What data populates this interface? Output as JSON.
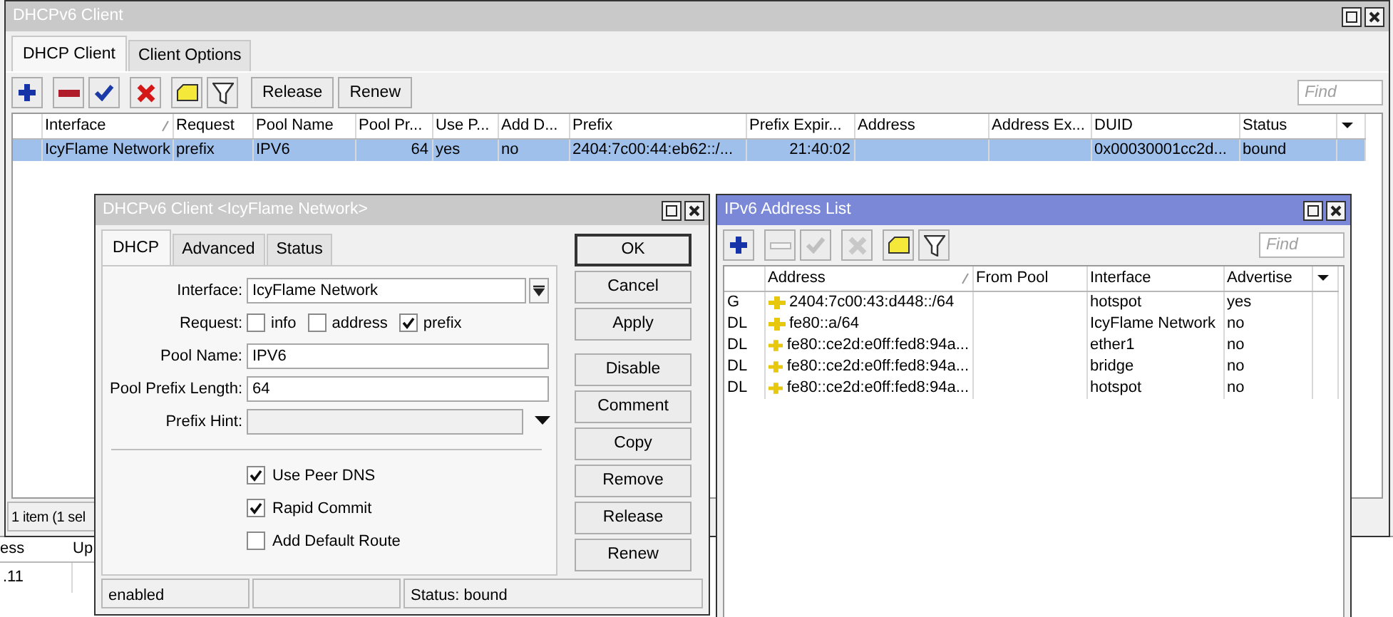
{
  "main_window": {
    "title": "DHCPv6 Client",
    "tabs": [
      {
        "label": "DHCP Client",
        "selected": true
      },
      {
        "label": "Client Options",
        "selected": false
      }
    ],
    "toolbar": {
      "icons": [
        {
          "kind": "add",
          "disabled": false
        },
        {
          "kind": "remove",
          "disabled": false
        },
        {
          "kind": "enable",
          "disabled": false
        },
        {
          "kind": "disable",
          "disabled": false
        },
        {
          "kind": "comment",
          "disabled": false
        },
        {
          "kind": "filter",
          "disabled": false
        }
      ],
      "buttons": [
        "Release",
        "Renew"
      ],
      "find_placeholder": "Find"
    },
    "table": {
      "columns": [
        {
          "label": "Interface",
          "sorted": true
        },
        {
          "label": "Request",
          "sorted": false
        },
        {
          "label": "Pool Name",
          "sorted": false
        },
        {
          "label": "Pool Pr...",
          "sorted": false
        },
        {
          "label": "Use P...",
          "sorted": false
        },
        {
          "label": "Add D...",
          "sorted": false
        },
        {
          "label": "Prefix",
          "sorted": false
        },
        {
          "label": "Prefix Expir...",
          "sorted": false
        },
        {
          "label": "Address",
          "sorted": false
        },
        {
          "label": "Address Ex...",
          "sorted": false
        },
        {
          "label": "DUID",
          "sorted": false
        },
        {
          "label": "Status",
          "sorted": false
        }
      ],
      "rows": [
        {
          "selected": true,
          "cells": [
            "IcyFlame Network",
            "prefix",
            "IPV6",
            "64",
            "yes",
            "no",
            "2404:7c00:44:eb62::/...",
            "21:40:02",
            null,
            null,
            "0x00030001cc2d...",
            "bound"
          ]
        }
      ]
    },
    "status_bar": "1 item (1 sel"
  },
  "background_table": {
    "columns": [
      "ess",
      "Up"
    ],
    "cells": [
      ".11"
    ]
  },
  "dialog": {
    "title": "DHCPv6 Client <IcyFlame Network>",
    "tabs": [
      {
        "label": "DHCP",
        "selected": true
      },
      {
        "label": "Advanced",
        "selected": false
      },
      {
        "label": "Status",
        "selected": false
      }
    ],
    "fields": [
      {
        "kind": "dropdown",
        "label": "Interface:",
        "value": "IcyFlame Network"
      },
      {
        "kind": "checks",
        "label": "Request:",
        "options": [
          {
            "label": "info",
            "checked": false
          },
          {
            "label": "address",
            "checked": false
          },
          {
            "label": "prefix",
            "checked": true
          }
        ]
      },
      {
        "kind": "text",
        "label": "Pool Name:",
        "value": "IPV6"
      },
      {
        "kind": "text",
        "label": "Pool Prefix Length:",
        "value": "64"
      },
      {
        "kind": "hint",
        "label": "Prefix Hint:"
      }
    ],
    "options": [
      {
        "label": "Use Peer DNS",
        "checked": true
      },
      {
        "label": "Rapid Commit",
        "checked": true
      },
      {
        "label": "Add Default Route",
        "checked": false
      }
    ],
    "buttons": [
      {
        "label": "OK",
        "default": true
      },
      {
        "label": "Cancel",
        "default": false
      },
      {
        "label": "Apply",
        "default": false
      },
      {
        "label": "Disable",
        "default": false
      },
      {
        "label": "Comment",
        "default": false
      },
      {
        "label": "Copy",
        "default": false
      },
      {
        "label": "Remove",
        "default": false
      },
      {
        "label": "Release",
        "default": false
      },
      {
        "label": "Renew",
        "default": false
      }
    ],
    "status_bar": [
      "enabled",
      "Status: bound"
    ]
  },
  "address_list": {
    "title": "IPv6 Address List",
    "toolbar": {
      "icons": [
        {
          "kind": "add",
          "disabled": false
        },
        {
          "kind": "remove",
          "disabled": true
        },
        {
          "kind": "enable",
          "disabled": true
        },
        {
          "kind": "disable",
          "disabled": true
        },
        {
          "kind": "comment",
          "disabled": false
        },
        {
          "kind": "filter",
          "disabled": false
        }
      ],
      "find_placeholder": "Find"
    },
    "columns": [
      {
        "label": "Address",
        "sorted": true
      },
      {
        "label": "From Pool",
        "sorted": false
      },
      {
        "label": "Interface",
        "sorted": false
      },
      {
        "label": "Advertise",
        "sorted": false
      }
    ],
    "rows": [
      {
        "flags": "G",
        "address": "2404:7c00:43:d448::/64",
        "interface": "hotspot",
        "advertise": "yes"
      },
      {
        "flags": "DL",
        "address": "fe80::a/64",
        "interface": "IcyFlame Network",
        "advertise": "no"
      },
      {
        "flags": "DL",
        "address": "fe80::ce2d:e0ff:fed8:94a...",
        "interface": "ether1",
        "advertise": "no"
      },
      {
        "flags": "DL",
        "address": "fe80::ce2d:e0ff:fed8:94a...",
        "interface": "bridge",
        "advertise": "no"
      },
      {
        "flags": "DL",
        "address": "fe80::ce2d:e0ff:fed8:94a...",
        "interface": "hotspot",
        "advertise": "no"
      }
    ]
  }
}
